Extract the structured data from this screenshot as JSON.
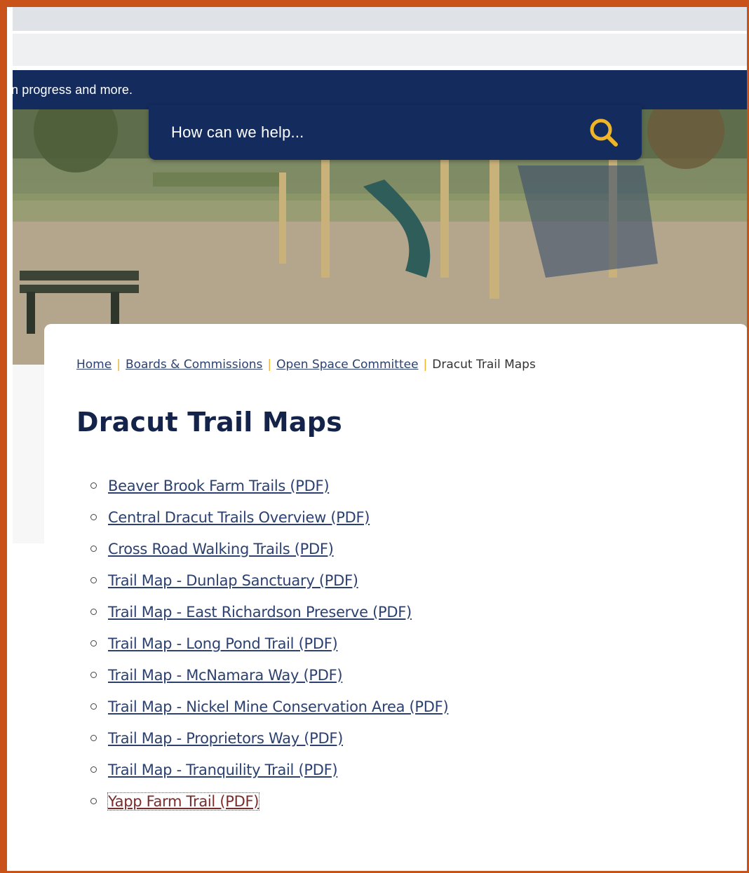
{
  "alert": {
    "text": "n progress and more."
  },
  "search": {
    "placeholder": "How can we help..."
  },
  "breadcrumb": {
    "home": "Home",
    "boards": "Boards & Commissions",
    "committee": "Open Space Committee",
    "current": "Dracut Trail Maps",
    "separator": "|"
  },
  "page": {
    "title": "Dracut Trail Maps"
  },
  "links": [
    "Beaver Brook Farm Trails (PDF)",
    "Central Dracut Trails Overview (PDF)",
    "Cross Road Walking Trails (PDF)",
    "Trail Map - Dunlap Sanctuary (PDF)",
    "Trail Map - East Richardson Preserve (PDF)",
    "Trail Map - Long Pond Trail (PDF)",
    "Trail Map - McNamara Way (PDF)",
    "Trail Map - Nickel Mine Conservation Area (PDF)",
    "Trail Map - Proprietors Way (PDF)",
    "Trail Map - Tranquility Trail (PDF)",
    "Yapp Farm Trail (PDF)"
  ],
  "icons": {
    "search": "search-icon",
    "bullet": "circle-bullet-icon"
  },
  "colors": {
    "navy": "#142b5d",
    "accent": "#f0b429",
    "link": "#2c4170",
    "frame": "#c8521a"
  }
}
